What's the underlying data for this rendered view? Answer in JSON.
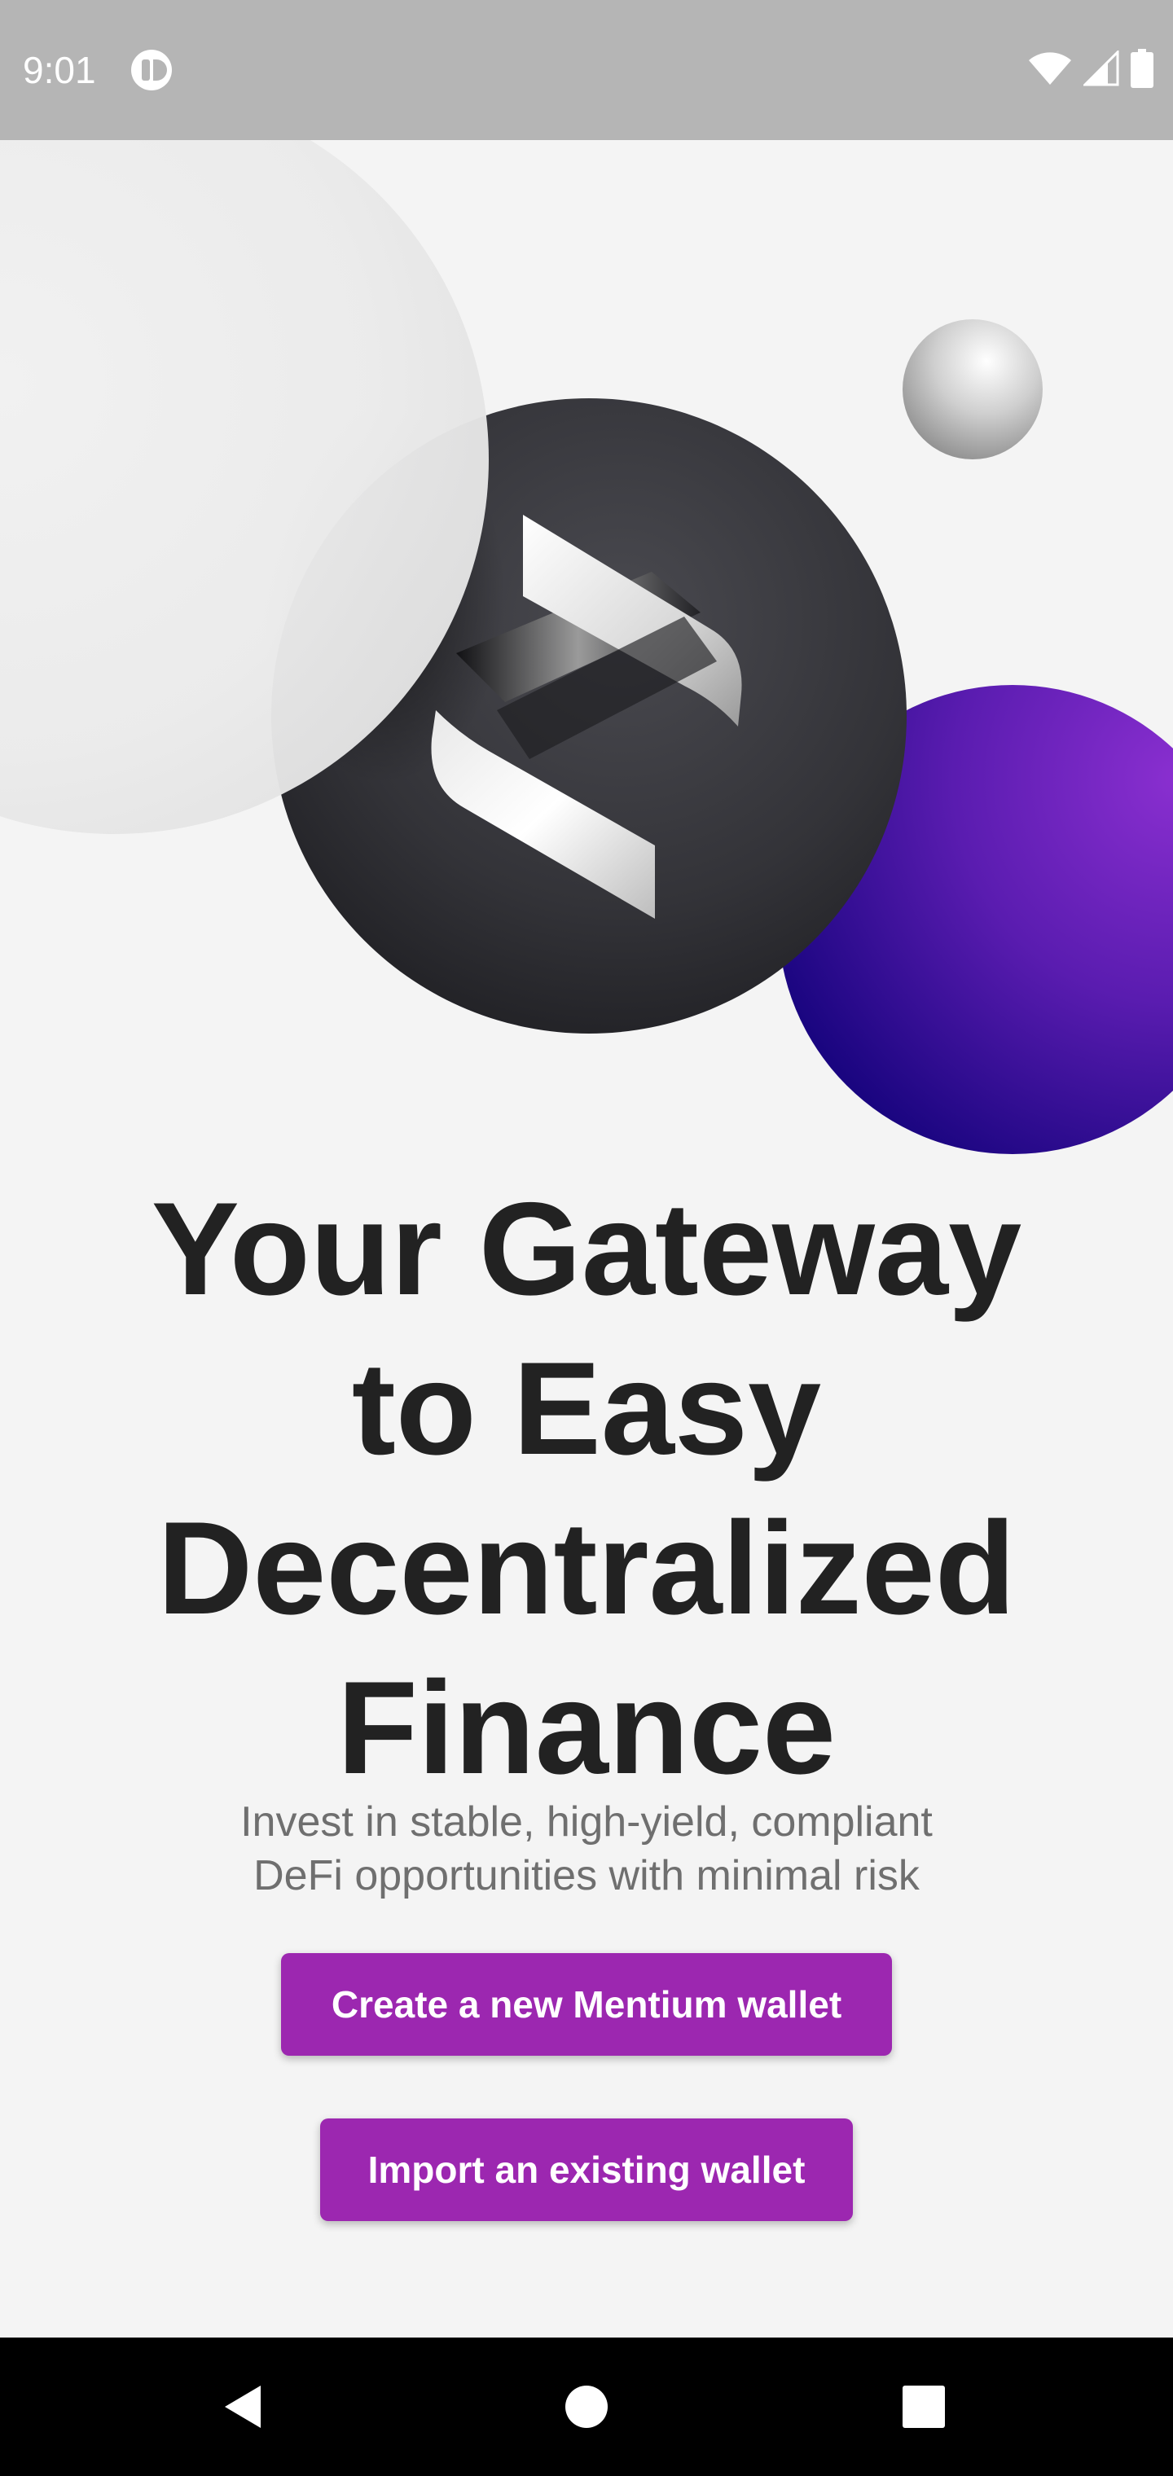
{
  "status_bar": {
    "time": "9:01",
    "icons": [
      "app-notification-icon",
      "wifi-icon",
      "cellular-signal-icon",
      "battery-icon"
    ]
  },
  "hero": {
    "icons": [
      "mentium-logo-icon"
    ],
    "colors": {
      "background": "#f4f4f4",
      "dark_sphere": "#2e2e33",
      "purple_sphere": "#8a2fd0",
      "purple_sphere_dark": "#1a0580"
    }
  },
  "onboarding": {
    "headline_lines": [
      "Your Gateway",
      "to Easy",
      "Decentralized",
      "Finance"
    ],
    "subtitle_lines": [
      "Invest in stable, high-yield, compliant",
      "DeFi opportunities with minimal risk"
    ]
  },
  "actions": {
    "create_wallet_label": "Create a new Mentium wallet",
    "import_wallet_label": "Import an existing wallet",
    "button_color": "#9c27b0"
  },
  "nav_bar": {
    "icons": [
      "back-icon",
      "home-icon",
      "recents-icon"
    ]
  }
}
